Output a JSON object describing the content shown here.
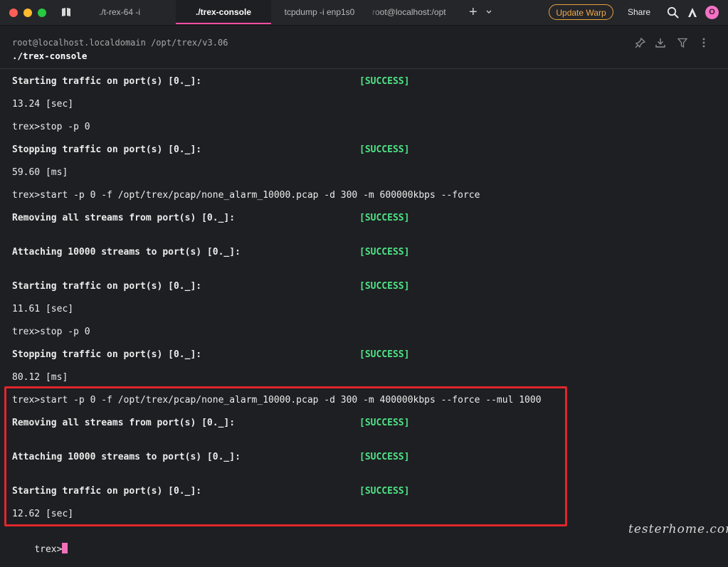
{
  "tabs": [
    {
      "label": "./t-rex-64 -i"
    },
    {
      "label": "./trex-console"
    },
    {
      "label": "tcpdump -i enp1s0"
    },
    {
      "label": "root@localhost:/opt"
    }
  ],
  "toolbar": {
    "update_label": "Update Warp",
    "share_label": "Share",
    "avatar_initial": "O"
  },
  "block": {
    "path": "root@localhost.localdomain /opt/trex/v3.06",
    "command": "./trex-console"
  },
  "output": [
    {
      "text": "Starting traffic on port(s) [0._]:",
      "status": "[SUCCESS]",
      "bold": true
    },
    {
      "text": "13.24 [sec]"
    },
    {
      "text": "trex>stop -p 0"
    },
    {
      "text": "Stopping traffic on port(s) [0._]:",
      "status": "[SUCCESS]",
      "bold": true
    },
    {
      "text": "59.60 [ms]"
    },
    {
      "text": "trex>start -p 0 -f /opt/trex/pcap/none_alarm_10000.pcap -d 300 -m 600000kbps --force"
    },
    {
      "text": "Removing all streams from port(s) [0._]:",
      "status": "[SUCCESS]",
      "bold": true
    },
    {
      "text": "Attaching 10000 streams to port(s) [0._]:",
      "status": "[SUCCESS]",
      "bold": true
    },
    {
      "text": "Starting traffic on port(s) [0._]:",
      "status": "[SUCCESS]",
      "bold": true
    },
    {
      "text": "11.61 [sec]"
    },
    {
      "text": "trex>stop -p 0"
    },
    {
      "text": "Stopping traffic on port(s) [0._]:",
      "status": "[SUCCESS]",
      "bold": true
    },
    {
      "text": "80.12 [ms]"
    },
    {
      "text": "trex>start -p 0 -f /opt/trex/pcap/none_alarm_10000.pcap -d 300 -m 400000kbps --force --mul 1000"
    },
    {
      "text": "Removing all streams from port(s) [0._]:",
      "status": "[SUCCESS]",
      "bold": true
    },
    {
      "text": "Attaching 10000 streams to port(s) [0._]:",
      "status": "[SUCCESS]",
      "bold": true
    },
    {
      "text": "Starting traffic on port(s) [0._]:",
      "status": "[SUCCESS]",
      "bold": true
    },
    {
      "text": "12.62 [sec]"
    }
  ],
  "prompt": "trex>",
  "watermark": "testerhome.com",
  "colors": {
    "accent": "#f54ea2",
    "success": "#4ee385",
    "highlight": "#e0262c",
    "update": "#f0a94a"
  }
}
